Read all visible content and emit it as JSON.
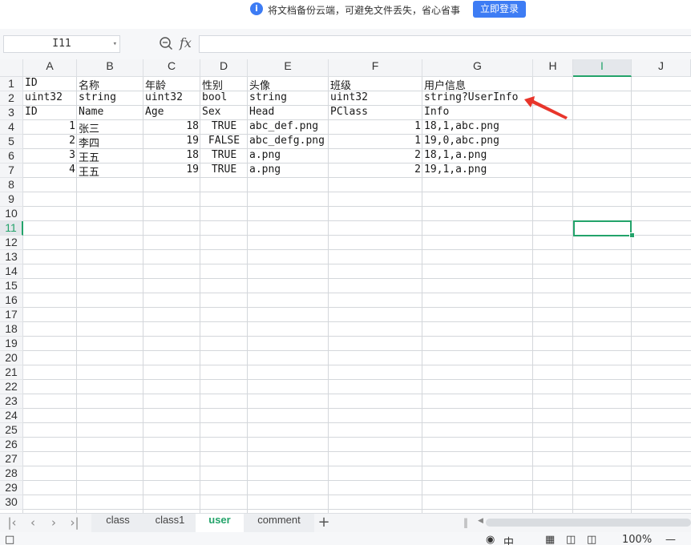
{
  "banner": {
    "info_glyph": "i",
    "text": "将文档备份云端，可避免文件丢失，省心省事",
    "login_button": "立即登录"
  },
  "formula_bar": {
    "name_box": "I11",
    "fx_label": "fx",
    "formula_value": ""
  },
  "sheet": {
    "columns": [
      "A",
      "B",
      "C",
      "D",
      "E",
      "F",
      "G",
      "H",
      "I",
      "J"
    ],
    "selected_column": "I",
    "selected_row": "11",
    "row_numbers": [
      "1",
      "2",
      "3",
      "4",
      "5",
      "6",
      "7",
      "8",
      "9",
      "10",
      "11",
      "12",
      "13",
      "14",
      "15",
      "16",
      "17",
      "18",
      "19",
      "20",
      "21",
      "22",
      "23",
      "24",
      "25",
      "26",
      "27",
      "28",
      "29",
      "30"
    ],
    "rows": [
      [
        "ID",
        "名称",
        "年龄",
        "性别",
        "头像",
        "班级",
        "用户信息"
      ],
      [
        "uint32",
        "string",
        "uint32",
        "bool",
        "string",
        "uint32",
        "string?UserInfo"
      ],
      [
        "ID",
        "Name",
        "Age",
        "Sex",
        "Head",
        "PClass",
        "Info"
      ],
      [
        "1",
        "张三",
        "18",
        "TRUE",
        "abc_def.png",
        "1",
        "18,1,abc.png"
      ],
      [
        "2",
        "李四",
        "19",
        "FALSE",
        "abc_defg.png",
        "1",
        "19,0,abc.png"
      ],
      [
        "3",
        "王五",
        "18",
        "TRUE",
        "a.png",
        "2",
        "18,1,a.png"
      ],
      [
        "4",
        "王五",
        "19",
        "TRUE",
        "a.png",
        "2",
        "19,1,a.png"
      ]
    ]
  },
  "tabs": {
    "sheets": [
      "class",
      "class1",
      "user",
      "comment"
    ],
    "active": "user",
    "add_label": "+"
  },
  "status_bar": {
    "eye_icon_label": "中",
    "zoom": "100%"
  },
  "colors": {
    "accent_green": "#23a36a",
    "brand_blue": "#3d7cf4",
    "annotation_red": "#e8352b"
  }
}
